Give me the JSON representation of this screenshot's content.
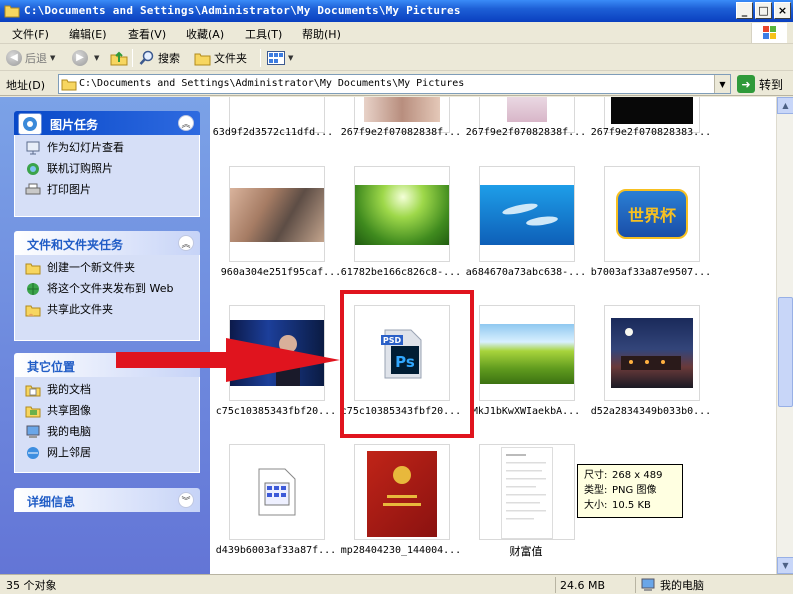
{
  "window": {
    "title": "C:\\Documents and Settings\\Administrator\\My Documents\\My Pictures",
    "controls": [
      "_",
      "□",
      "×"
    ]
  },
  "menu": [
    "文件(F)",
    "编辑(E)",
    "查看(V)",
    "收藏(A)",
    "工具(T)",
    "帮助(H)"
  ],
  "toolbar": {
    "back": "后退",
    "search": "搜索",
    "folders": "文件夹"
  },
  "address": {
    "label": "地址(D)",
    "path": "C:\\Documents and Settings\\Administrator\\My Documents\\My Pictures",
    "go": "转到"
  },
  "sidebar": {
    "picture_tasks": {
      "title": "图片任务",
      "items": [
        "作为幻灯片查看",
        "联机订购照片",
        "打印图片"
      ]
    },
    "file_tasks": {
      "title": "文件和文件夹任务",
      "items": [
        "创建一个新文件夹",
        "将这个文件夹发布到 Web",
        "共享此文件夹"
      ]
    },
    "other_places": {
      "title": "其它位置",
      "items": [
        "我的文档",
        "共享图像",
        "我的电脑",
        "网上邻居"
      ]
    },
    "details": {
      "title": "详细信息"
    }
  },
  "files": {
    "row0": [
      "63d9f2d3572c11dfd...",
      "267f9e2f07082838f...",
      "267f9e2f07082838f...",
      "267f9e2f070828383..."
    ],
    "row1": [
      "960a304e251f95caf...",
      "61782be166c826c8-...",
      "a684670a73abc638-...",
      "b7003af33a87e9507..."
    ],
    "row2": [
      "c75c10385343fbf20...",
      "c75c10385343fbf20...",
      "MkJ1bKwXWIaekbA...",
      "d52a2834349b033b0..."
    ],
    "row3": [
      "d439b6003af33a87f...",
      "mp28404230_144004...",
      "财富值"
    ]
  },
  "psd_label": "PSD",
  "psd_ps": "Ps",
  "worldcup_text": "世界杯",
  "tooltip": {
    "size_label": "尺寸:",
    "size_value": "268 x 489",
    "type_label": "类型:",
    "type_value": "PNG 图像",
    "filesize_label": "大小:",
    "filesize_value": "10.5 KB"
  },
  "status": {
    "objects": "35 个对象",
    "size": "24.6 MB",
    "location": "我的电脑"
  },
  "colors": {
    "titlebar": "#0a3fbf",
    "sidebar": "#6375d6",
    "highlight": "#e0141e"
  }
}
